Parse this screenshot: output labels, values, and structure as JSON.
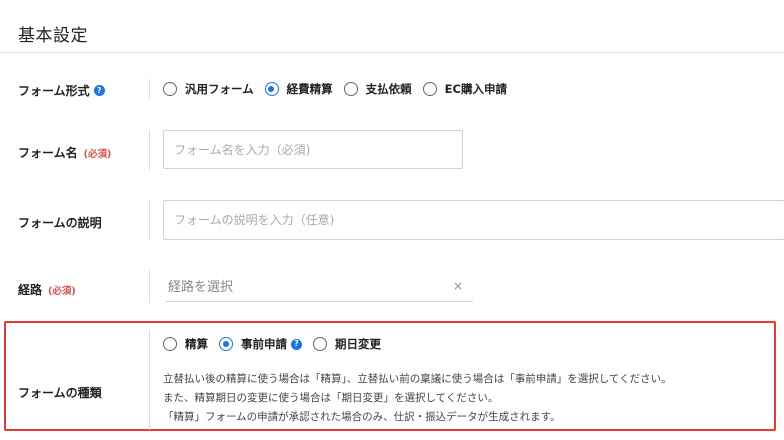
{
  "section": {
    "title": "基本設定"
  },
  "form_type": {
    "label": "フォーム形式",
    "options": [
      {
        "label": "汎用フォーム",
        "checked": false
      },
      {
        "label": "経費精算",
        "checked": true
      },
      {
        "label": "支払依頼",
        "checked": false
      },
      {
        "label": "EC購入申請",
        "checked": false
      }
    ]
  },
  "form_name": {
    "label": "フォーム名",
    "required": "(必須)",
    "placeholder": "フォーム名を入力（必須)",
    "value": ""
  },
  "form_description": {
    "label": "フォームの説明",
    "placeholder": "フォームの説明を入力（任意)",
    "value": ""
  },
  "route": {
    "label": "経路",
    "required": "(必須)",
    "placeholder": "経路を選択",
    "clear_icon": "×"
  },
  "form_kind": {
    "label": "フォームの種類",
    "options": [
      {
        "label": "精算",
        "checked": false
      },
      {
        "label": "事前申請",
        "checked": true,
        "help": true
      },
      {
        "label": "期日変更",
        "checked": false
      }
    ],
    "help_lines": [
      "立替払い後の精算に使う場合は「精算」、立替払い前の稟議に使う場合は「事前申請」を選択してください。",
      "また、精算期日の変更に使う場合は「期日変更」を選択してください。",
      "「精算」フォームの申請が承認された場合のみ、仕訳・振込データが生成されます。"
    ]
  },
  "icons": {
    "help": "?"
  },
  "colors": {
    "accent": "#1a73e8",
    "required": "#d9534f",
    "highlight": "#e53935"
  }
}
